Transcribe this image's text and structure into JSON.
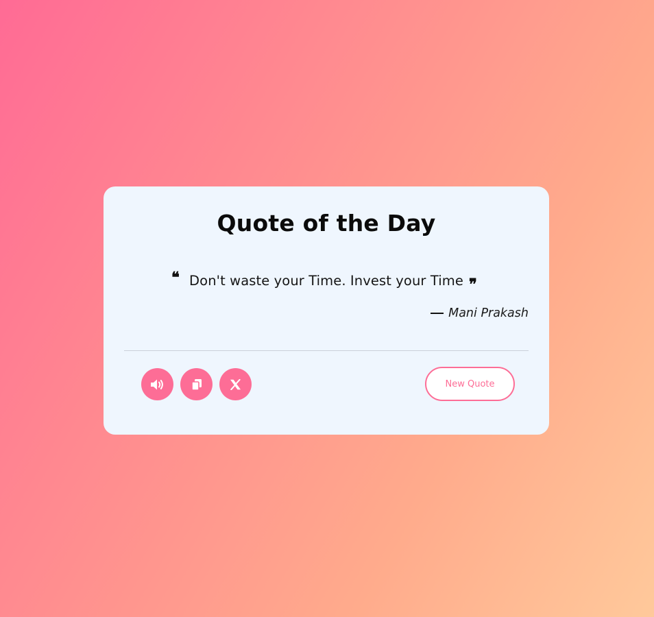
{
  "page": {
    "background_gradient": [
      "#ff6b95",
      "#ffc99b"
    ]
  },
  "card": {
    "title": "Quote of the Day",
    "quote": "Don't waste your Time. Invest your Time",
    "author_dash": "—",
    "author": "Mani Prakash"
  },
  "actions": {
    "speak_icon": "volume-icon",
    "copy_icon": "copy-icon",
    "share_icon": "x-twitter-icon",
    "new_quote_label": "New Quote"
  },
  "colors": {
    "accent": "#fd6d96",
    "card_bg": "#eff6fe",
    "text": "#111111"
  }
}
